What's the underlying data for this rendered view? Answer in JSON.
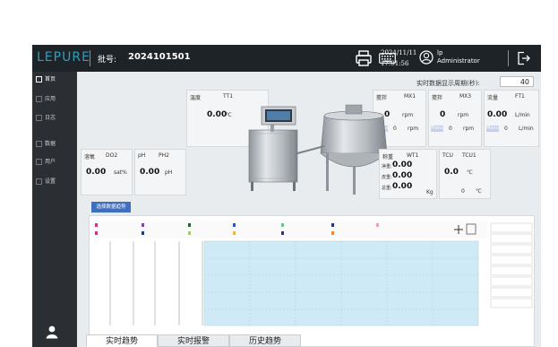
{
  "header": {
    "logo": "LEPURE",
    "batch_label": "批号:",
    "batch_value": "2024101501",
    "date": "2024/11/11",
    "time": "17:01:56",
    "user_line1": "lp",
    "user_line2": "Administrator"
  },
  "sidebar": {
    "items": [
      {
        "label": "首页"
      },
      {
        "label": "应用"
      },
      {
        "label": "日志"
      },
      {
        "label": "数据"
      },
      {
        "label": "用户"
      },
      {
        "label": "设置"
      }
    ]
  },
  "main": {
    "period_label": "实时数据显示周期(秒):",
    "period_value": "40",
    "temp": {
      "caption": "温度",
      "tag": "TT1",
      "value": "0.00",
      "unit": "℃"
    },
    "mix1": {
      "caption": "搅拌",
      "tag": "MX1",
      "value": "0",
      "unit": "rpm",
      "manu_value": "0",
      "manu_unit": "rpm",
      "manu_label": "Manu"
    },
    "mix3": {
      "caption": "搅拌",
      "tag": "MX3",
      "value": "0",
      "unit": "rpm",
      "manu_value": "0",
      "manu_unit": "rpm",
      "manu_label": "Manu"
    },
    "flow": {
      "caption": "流量",
      "tag": "FT1",
      "value": "0.00",
      "unit": "L/min",
      "manu_value": "0",
      "manu_unit": "L/min",
      "manu_label": "Manu"
    },
    "oxygen": {
      "caption": "溶氧",
      "tag": "DO2",
      "value": "0.00",
      "unit": "sat%"
    },
    "ph": {
      "caption": "pH",
      "tag": "PH2",
      "value": "0.00",
      "unit": "pH"
    },
    "weight": {
      "caption": "称重",
      "tag": "WT1",
      "rows": [
        {
          "label": "净重:",
          "value": "0.00"
        },
        {
          "label": "皮重:",
          "value": "0.00"
        },
        {
          "label": "总重:",
          "value": "0.00"
        }
      ],
      "unit": "Kg"
    },
    "tcu": {
      "caption": "TCU",
      "tag": "TCU1",
      "value": "0.0",
      "unit": "℃",
      "value2": "0",
      "unit2": "℃"
    },
    "select_button": "选择数据趋势"
  },
  "tabs": [
    "实时趋势",
    "实时报警",
    "历史趋势"
  ]
}
